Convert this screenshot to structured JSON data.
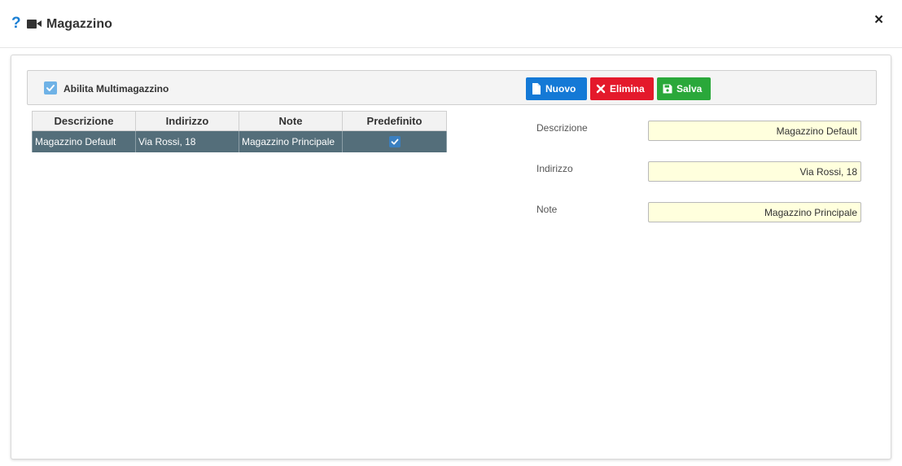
{
  "dialog": {
    "title": "Magazzino",
    "help_icon": "?",
    "close_icon": "×"
  },
  "toolbar": {
    "multi_label": "Abilita Multimagazzino",
    "multi_checked": true,
    "buttons": {
      "nuovo": "Nuovo",
      "elimina": "Elimina",
      "salva": "Salva"
    },
    "colors": {
      "nuovo": "#1479d6",
      "elimina": "#e4192b",
      "salva": "#2aa83a"
    }
  },
  "grid": {
    "columns": [
      "Descrizione",
      "Indirizzo",
      "Note",
      "Predefinito"
    ],
    "rows": [
      {
        "descrizione": "Magazzino Default",
        "indirizzo": "Via Rossi, 18",
        "note": "Magazzino Principale",
        "predefinito": true
      }
    ]
  },
  "form": {
    "descrizione_label": "Descrizione",
    "descrizione_value": "Magazzino Default",
    "indirizzo_label": "Indirizzo",
    "indirizzo_value": "Via Rossi, 18",
    "note_label": "Note",
    "note_value": "Magazzino Principale"
  }
}
